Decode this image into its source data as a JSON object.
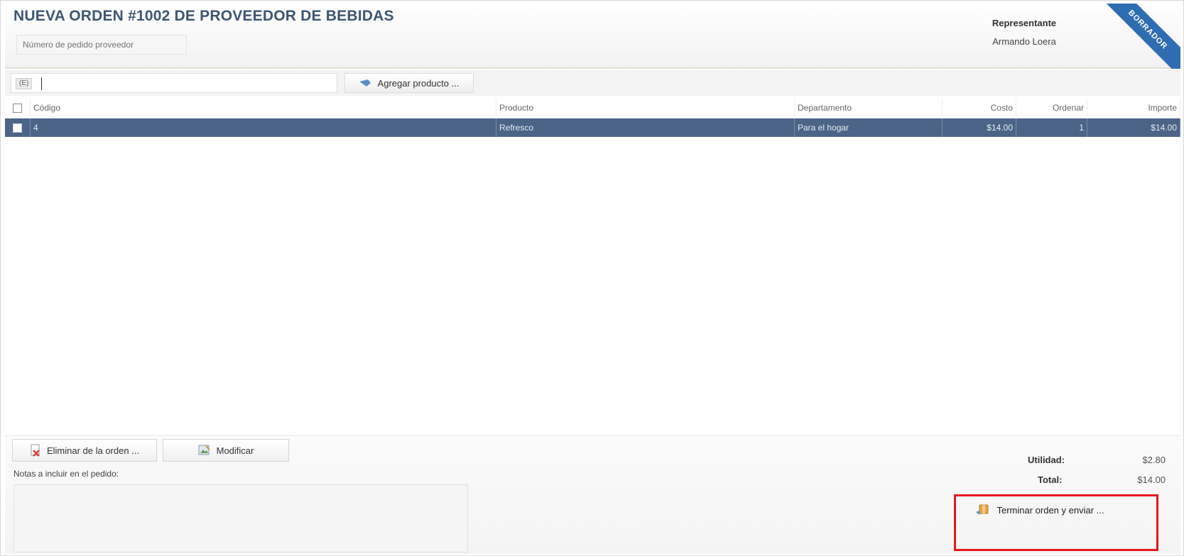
{
  "header": {
    "title": "NUEVA ORDEN #1002 DE PROVEEDOR DE BEBIDAS",
    "supplier_order_placeholder": "Número de pedido proveedor",
    "representative_label": "Representante",
    "representative_name": "Armando Loera",
    "ribbon_text": "BORRADOR"
  },
  "toolbar": {
    "search_tag": "(E)",
    "add_product_label": "Agregar producto ..."
  },
  "table": {
    "columns": [
      "Código",
      "Producto",
      "Departamento",
      "Costo",
      "Ordenar",
      "Importe"
    ],
    "rows": [
      {
        "code": "4",
        "product": "Refresco",
        "department": "Para el hogar",
        "cost": "$14.00",
        "order": "1",
        "amount": "$14.00"
      }
    ]
  },
  "actions": {
    "delete_label": "Eliminar de la orden ...",
    "modify_label": "Modificar",
    "notes_label": "Notas a incluir en el pedido:",
    "finish_label": "Terminar orden y enviar ..."
  },
  "summary": {
    "utility_label": "Utilidad:",
    "utility_value": "$2.80",
    "total_label": "Total:",
    "total_value": "$14.00"
  },
  "colors": {
    "title": "#3d5670",
    "selected_row": "#4b6487",
    "ribbon": "#2f6db2",
    "highlight": "#e8161b"
  }
}
